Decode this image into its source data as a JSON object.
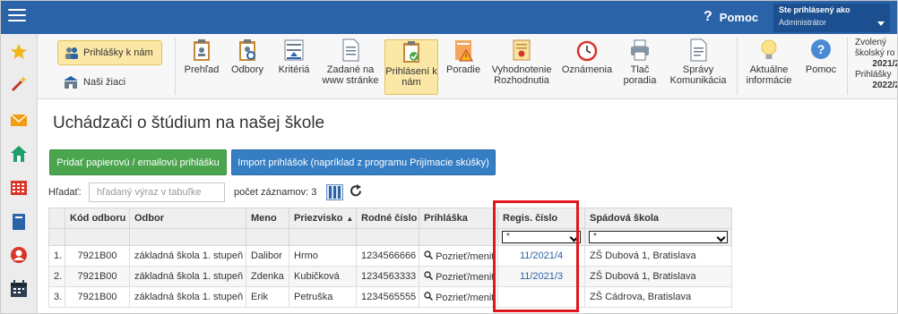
{
  "topbar": {
    "help_label": "Pomoc",
    "user_line1": "Ste prihlásený ako",
    "user_role": "Administrátor",
    "bg_color": "#2a63a8"
  },
  "sidebar": {
    "icons": [
      "star-icon",
      "magic-wand-icon",
      "mail-icon",
      "home-icon",
      "calendar-grid-icon",
      "book-icon",
      "user-icon",
      "calendar-icon"
    ]
  },
  "toolbar": {
    "applications_label": "Prihlášky k nám",
    "our_students_label": "Naši žiaci",
    "items": [
      {
        "label": "Prehľad",
        "icon": "clipboard-icon"
      },
      {
        "label": "Odbory",
        "icon": "clipboard-search-icon"
      },
      {
        "label": "Kritériá",
        "icon": "criteria-icon"
      },
      {
        "label": "Zadané na www stránke",
        "icon": "document-icon"
      },
      {
        "label": "Prihlásení k nám",
        "icon": "clipboard-check-icon"
      },
      {
        "label": "Poradie",
        "icon": "warning-document-icon"
      },
      {
        "label": "Vyhodnotenie Rozhodnutia",
        "icon": "certificate-icon"
      },
      {
        "label": "Oznámenia",
        "icon": "alarm-clock-icon"
      },
      {
        "label": "Tlač poradia",
        "icon": "printer-icon"
      },
      {
        "label": "Správy Komunikácia",
        "icon": "message-document-icon"
      },
      {
        "label": "Aktuálne informácie",
        "icon": "lightbulb-icon"
      },
      {
        "label": "Pomoc",
        "icon": "help-icon"
      }
    ],
    "year_info": {
      "line1": "Zvolený",
      "line2": "školský ro",
      "line3": "2021/2",
      "line4": "Prihlášky",
      "line5": "2022/2"
    }
  },
  "main": {
    "title": "Uchádzači o štúdium na našej škole",
    "add_button": "Pridať papierovú / emailovú prihlášku",
    "import_button": "Import prihlášok (napríklad z programu Prijímacie skúšky)",
    "search_label": "Hľadať:",
    "search_placeholder": "hľadaný výraz v tabuľke",
    "count_label": "počet záznamov: 3"
  },
  "table": {
    "columns": [
      "",
      "Kód odboru",
      "Odbor",
      "Meno",
      "Priezvisko",
      "Rodné číslo",
      "Prihláška",
      "Regis. číslo",
      "Spádová škola"
    ],
    "filter_value": "*",
    "rows": [
      {
        "idx": "1.",
        "code": "7921B00",
        "field": "základná škola 1. stupeň",
        "first": "Dalibor",
        "last": "Hrmo",
        "birth": "1234566666",
        "app": "Pozrieť/meniť",
        "reg": "11/2021/4",
        "school": "ZŠ Dubová 1, Bratislava"
      },
      {
        "idx": "2.",
        "code": "7921B00",
        "field": "základná škola 1. stupeň",
        "first": "Zdenka",
        "last": "Kubičková",
        "birth": "1234563333",
        "app": "Pozrieť/meniť",
        "reg": "11/2021/3",
        "school": "ZŠ Dubová 1, Bratislava"
      },
      {
        "idx": "3.",
        "code": "7921B00",
        "field": "základná škola 1. stupeň",
        "first": "Erik",
        "last": "Petruška",
        "birth": "1234565555",
        "app": "Pozrieť/meniť",
        "reg": "",
        "school": "ZŠ Cádrova, Bratislava"
      }
    ]
  }
}
